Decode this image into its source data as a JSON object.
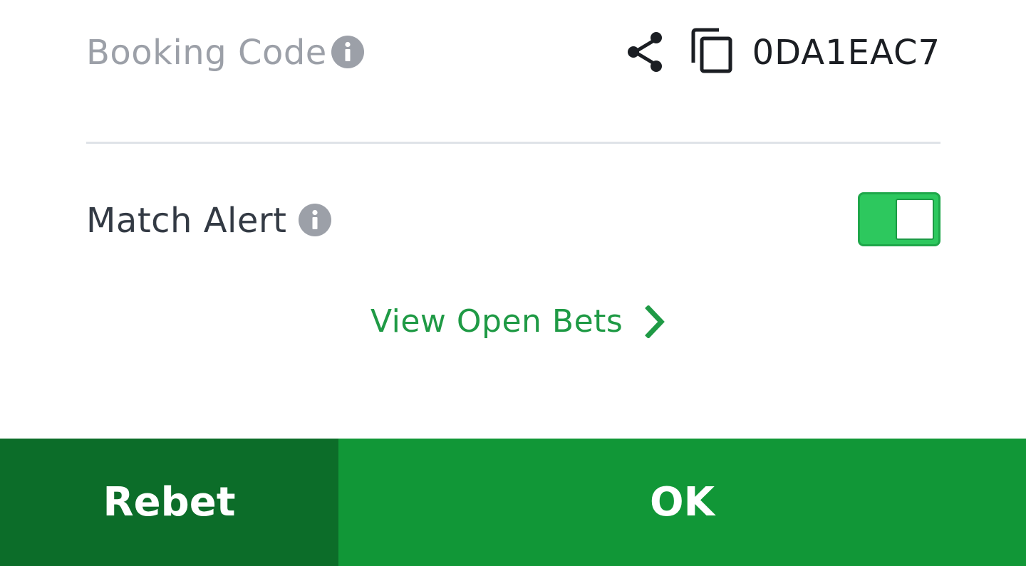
{
  "booking": {
    "label": "Booking Code",
    "code": "0DA1EAC7"
  },
  "match_alert": {
    "label": "Match Alert",
    "enabled": true
  },
  "open_bets": {
    "label": "View Open Bets"
  },
  "footer": {
    "rebet_label": "Rebet",
    "ok_label": "OK"
  },
  "colors": {
    "primary_green": "#119737",
    "dark_green": "#0c6d29",
    "toggle_green": "#2dc85e",
    "link_green": "#1f9a45",
    "muted_gray": "#9ca0a8"
  },
  "icons": {
    "booking_info": "info-icon",
    "share": "share-icon",
    "copy": "copy-icon",
    "alert_info": "info-icon",
    "chevron": "chevron-right-icon"
  }
}
